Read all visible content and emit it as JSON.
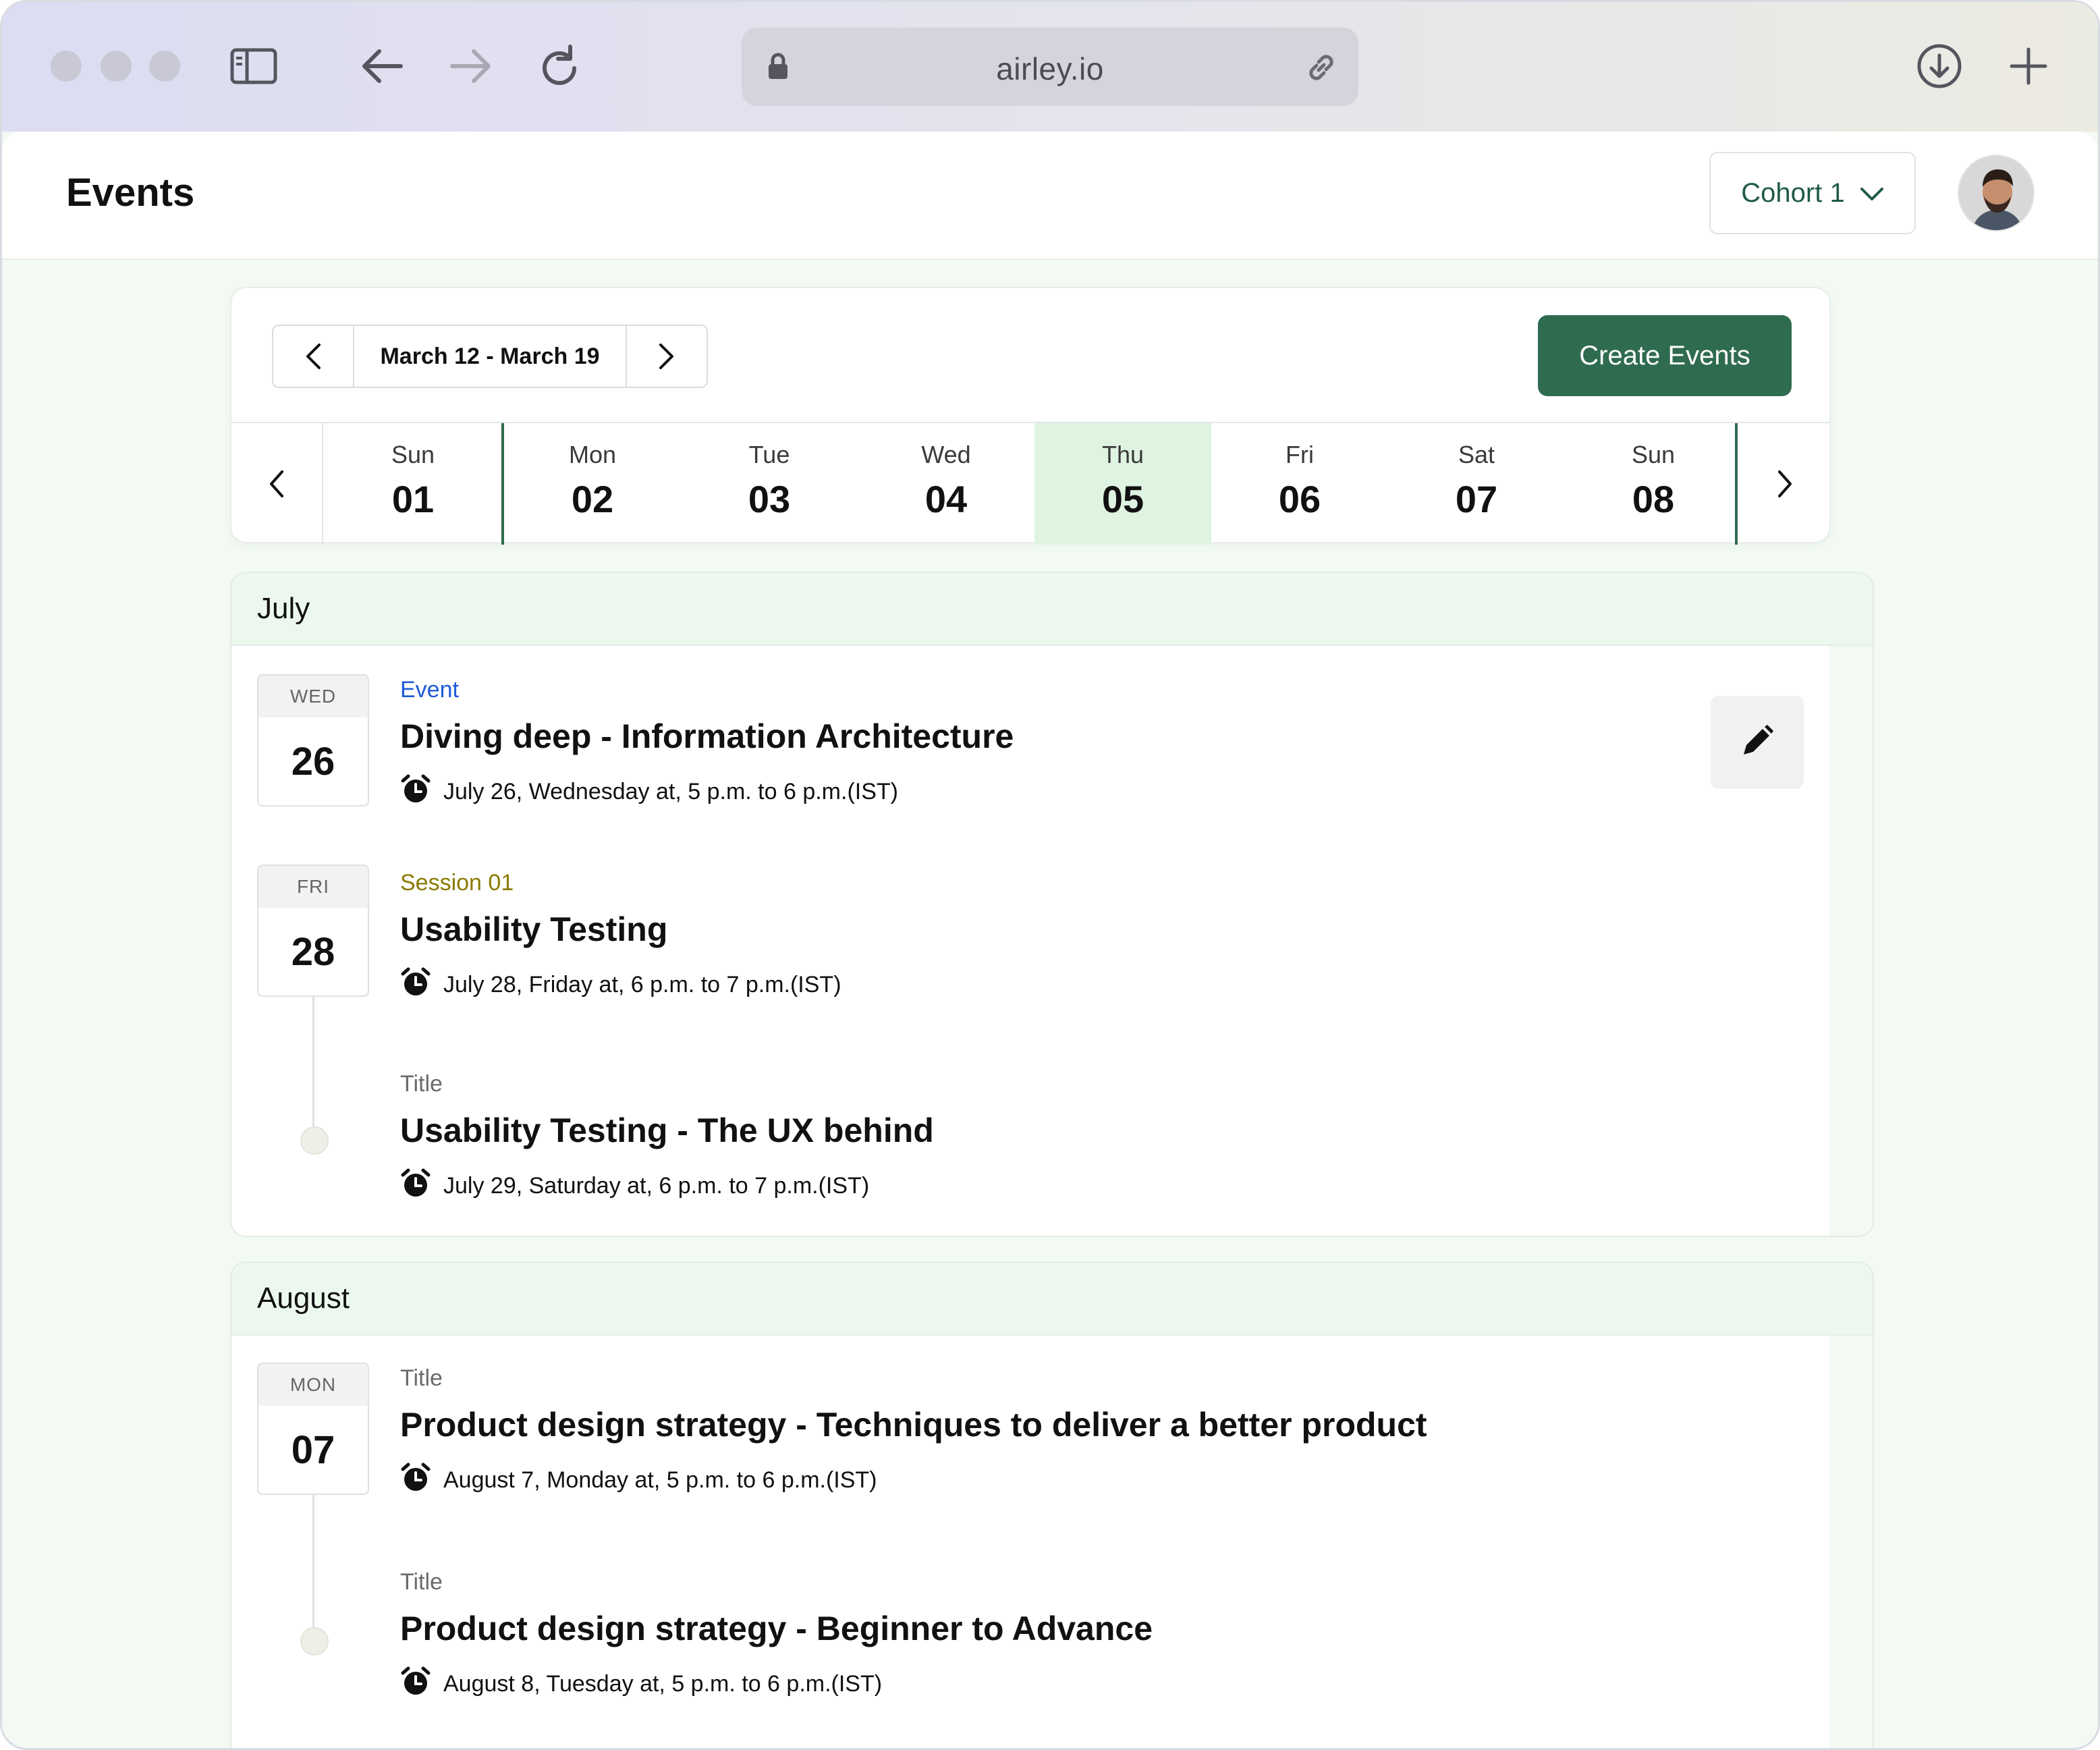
{
  "browser": {
    "url": "airley.io"
  },
  "header": {
    "title": "Events",
    "cohort_label": "Cohort 1"
  },
  "week": {
    "range_label": "March 12 - March 19",
    "create_label": "Create Events",
    "days": [
      {
        "name": "Sun",
        "date": "01"
      },
      {
        "name": "Mon",
        "date": "02"
      },
      {
        "name": "Tue",
        "date": "03"
      },
      {
        "name": "Wed",
        "date": "04"
      },
      {
        "name": "Thu",
        "date": "05"
      },
      {
        "name": "Fri",
        "date": "06"
      },
      {
        "name": "Sat",
        "date": "07"
      },
      {
        "name": "Sun",
        "date": "08"
      }
    ],
    "selected_day": "05"
  },
  "months": [
    {
      "name": "July",
      "events": [
        {
          "weekday": "WED",
          "day": "26",
          "tag": "Event",
          "title": "Diving deep - Information Architecture",
          "when": "July 26, Wednesday at, 5 p.m. to 6 p.m.(IST)"
        },
        {
          "weekday": "FRI",
          "day": "28",
          "tag": "Session 01",
          "title": "Usability Testing",
          "when": "July 28, Friday at, 6 p.m. to 7 p.m.(IST)"
        },
        {
          "tag": "Title",
          "title": "Usability Testing - The UX behind",
          "when": "July 29, Saturday at, 6 p.m. to 7 p.m.(IST)"
        }
      ]
    },
    {
      "name": "August",
      "events": [
        {
          "weekday": "MON",
          "day": "07",
          "tag": "Title",
          "title": "Product design strategy - Techniques to deliver a better product",
          "when": "August 7, Monday at, 5 p.m. to 6 p.m.(IST)"
        },
        {
          "tag": "Title",
          "title": "Product design strategy - Beginner to Advance",
          "when": "August 8, Tuesday at, 5 p.m. to 6 p.m.(IST)"
        }
      ]
    }
  ],
  "colors": {
    "accent": "#2f6b4f",
    "selected_day_bg": "#dff3e1",
    "event_tag": "#1e5ad8",
    "session_tag": "#8a7a00"
  }
}
